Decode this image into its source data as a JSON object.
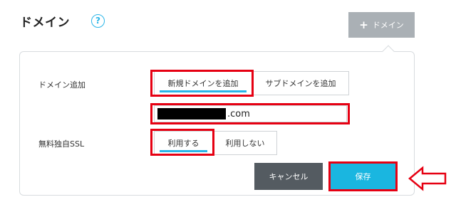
{
  "header": {
    "title": "ドメイン",
    "help_icon": "?",
    "add_button_icon": "+",
    "add_button_label": "ドメイン"
  },
  "form": {
    "domain_add": {
      "label": "ドメイン追加",
      "options": [
        "新規ドメインを追加",
        "サブドメインを追加"
      ],
      "selected": "新規ドメインを追加"
    },
    "domain_input": {
      "value_suffix": ".com"
    },
    "ssl": {
      "label": "無料独自SSL",
      "options": [
        "利用する",
        "利用しない"
      ],
      "selected": "利用する"
    }
  },
  "actions": {
    "cancel_label": "キャンセル",
    "save_label": "保存"
  },
  "colors": {
    "accent": "#1ab6e0",
    "highlight": "#e60012",
    "cancel": "#545b61",
    "add_button": "#aab0b5"
  },
  "icons": {
    "help": "question-circle-icon",
    "add": "plus-icon",
    "pointer": "arrow-left-outline-icon"
  }
}
